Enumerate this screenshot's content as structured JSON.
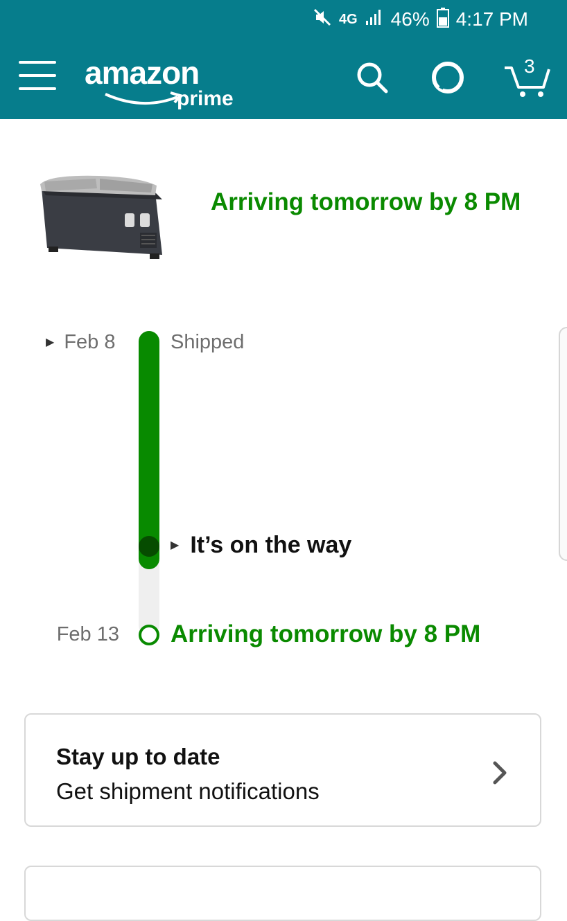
{
  "status_bar": {
    "network": "4G",
    "battery": "46%",
    "time": "4:17 PM"
  },
  "header": {
    "logo_text": "amazon",
    "logo_sub": "prime",
    "cart_count": "3",
    "icons": [
      "menu-icon",
      "search-icon",
      "alexa-icon",
      "cart-icon"
    ],
    "brand_color": "#067d8c"
  },
  "summary": {
    "heading": "Arriving tomorrow by 8 PM",
    "accent_color": "#0a8a00"
  },
  "timeline": {
    "events": [
      {
        "date": "Feb 8",
        "label": "Shipped"
      },
      {
        "date": "",
        "label": "It’s on the way"
      },
      {
        "date": "Feb 13",
        "label": "Arriving tomorrow by 8 PM"
      }
    ]
  },
  "notifications": {
    "title": "Stay up to date",
    "subtitle": "Get shipment notifications"
  }
}
